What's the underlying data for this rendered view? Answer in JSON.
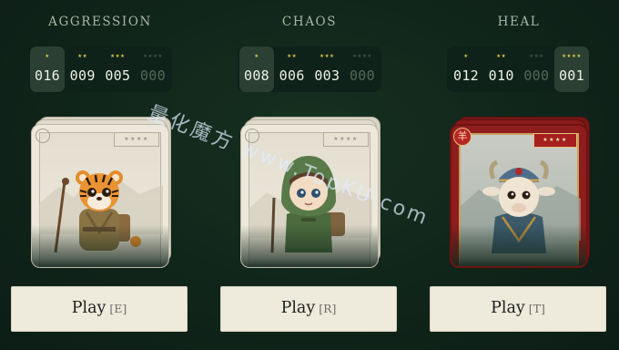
{
  "columns": [
    {
      "title": "AGGRESSION",
      "counters": [
        {
          "stars": "★",
          "value": "016",
          "active": true
        },
        {
          "stars": "★★",
          "value": "009",
          "active": false
        },
        {
          "stars": "★★★",
          "value": "005",
          "active": false
        },
        {
          "stars": "★★★★",
          "value": "000",
          "active": false
        }
      ],
      "card": {
        "rarity": "common",
        "badge_stars": "★★★★",
        "character": "tiger"
      },
      "play_label": "Play",
      "play_key": "[E]"
    },
    {
      "title": "CHAOS",
      "counters": [
        {
          "stars": "★",
          "value": "008",
          "active": true
        },
        {
          "stars": "★★",
          "value": "006",
          "active": false
        },
        {
          "stars": "★★★",
          "value": "003",
          "active": false
        },
        {
          "stars": "★★★★",
          "value": "000",
          "active": false
        }
      ],
      "card": {
        "rarity": "common",
        "badge_stars": "★★★★",
        "character": "hooded-child"
      },
      "play_label": "Play",
      "play_key": "[R]"
    },
    {
      "title": "HEAL",
      "counters": [
        {
          "stars": "★",
          "value": "012",
          "active": false
        },
        {
          "stars": "★★",
          "value": "010",
          "active": false
        },
        {
          "stars": "★★★",
          "value": "000",
          "active": false
        },
        {
          "stars": "★★★★",
          "value": "001",
          "active": true
        }
      ],
      "card": {
        "rarity": "legendary",
        "badge_stars": "★★★★",
        "seal_char": "羊",
        "character": "goat"
      },
      "play_label": "Play",
      "play_key": "[T]"
    }
  ],
  "watermark": "量化魔方 www.TopKU.com",
  "colors": {
    "background": "#10241a",
    "title": "#a9b7a3",
    "count_active": "#eef2e8",
    "count_dim": "#55685a",
    "star_active": "#d9c24a",
    "button_bg": "#eeeadc",
    "rare_frame": "#8e1d1d"
  }
}
